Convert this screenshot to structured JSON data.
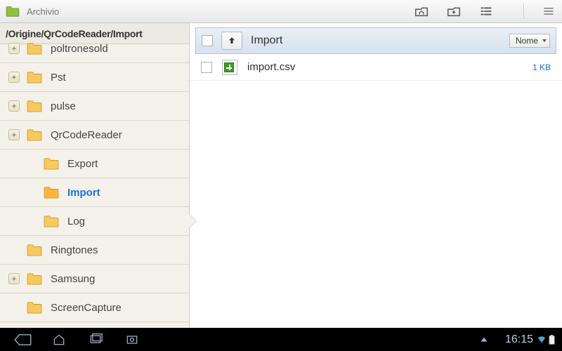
{
  "app": {
    "title": "Archivio"
  },
  "breadcrumb": "/Origine/QrCodeReader/Import",
  "tree": [
    {
      "label": "poltronesold",
      "expandable": true,
      "depth": 0
    },
    {
      "label": "Pst",
      "expandable": true,
      "depth": 0
    },
    {
      "label": "pulse",
      "expandable": true,
      "depth": 0
    },
    {
      "label": "QrCodeReader",
      "expandable": true,
      "depth": 0
    },
    {
      "label": "Export",
      "expandable": false,
      "depth": 1
    },
    {
      "label": "Import",
      "expandable": false,
      "depth": 1,
      "selected": true
    },
    {
      "label": "Log",
      "expandable": false,
      "depth": 1
    },
    {
      "label": "Ringtones",
      "expandable": false,
      "depth": 0
    },
    {
      "label": "Samsung",
      "expandable": true,
      "depth": 0
    },
    {
      "label": "ScreenCapture",
      "expandable": false,
      "depth": 0
    }
  ],
  "content": {
    "folder_name": "Import",
    "sort_label": "Nome",
    "files": [
      {
        "name": "import.csv",
        "size": "1 KB"
      }
    ]
  },
  "statusbar": {
    "time": "16:15"
  }
}
